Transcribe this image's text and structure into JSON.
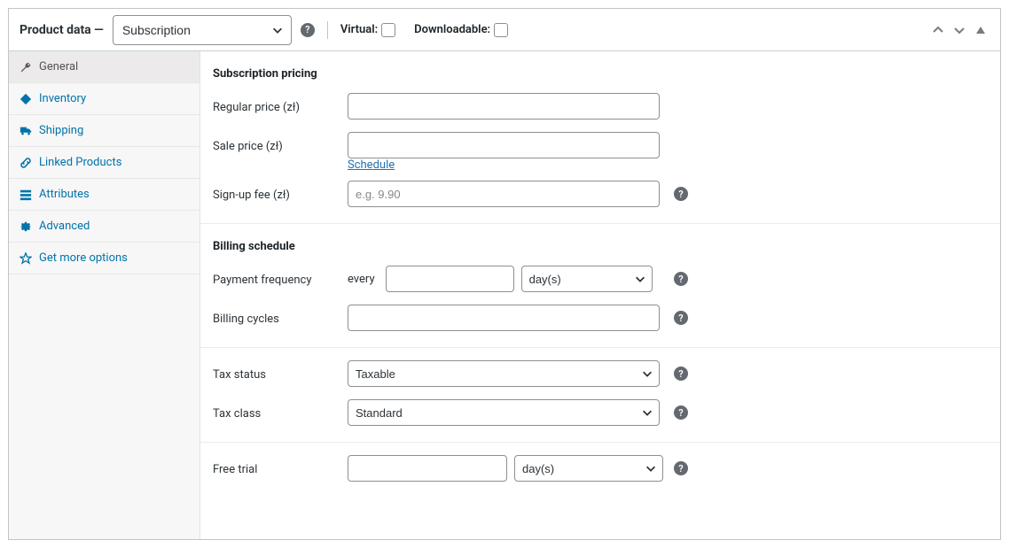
{
  "header": {
    "title": "Product data —",
    "product_type_selected": "Subscription",
    "virtual_label": "Virtual:",
    "downloadable_label": "Downloadable:"
  },
  "tabs": [
    {
      "key": "general",
      "label": "General",
      "icon": "wrench-icon",
      "active": true
    },
    {
      "key": "inventory",
      "label": "Inventory",
      "icon": "diamond-icon",
      "active": false
    },
    {
      "key": "shipping",
      "label": "Shipping",
      "icon": "truck-icon",
      "active": false
    },
    {
      "key": "linked",
      "label": "Linked Products",
      "icon": "link-icon",
      "active": false
    },
    {
      "key": "attrs",
      "label": "Attributes",
      "icon": "list-icon",
      "active": false
    },
    {
      "key": "advanced",
      "label": "Advanced",
      "icon": "gear-icon",
      "active": false
    },
    {
      "key": "more",
      "label": "Get more options",
      "icon": "star-icon",
      "active": false
    }
  ],
  "sections": {
    "pricing": {
      "title": "Subscription pricing",
      "regular_label": "Regular price (zł)",
      "regular_value": "",
      "sale_label": "Sale price (zł)",
      "sale_value": "",
      "schedule_link": "Schedule",
      "signup_label": "Sign-up fee (zł)",
      "signup_value": "",
      "signup_placeholder": "e.g. 9.90"
    },
    "billing": {
      "title": "Billing schedule",
      "freq_label": "Payment frequency",
      "every_text": "every",
      "freq_value": "",
      "freq_unit_selected": "day(s)",
      "cycles_label": "Billing cycles",
      "cycles_value": ""
    },
    "tax": {
      "status_label": "Tax status",
      "status_selected": "Taxable",
      "class_label": "Tax class",
      "class_selected": "Standard"
    },
    "trial": {
      "label": "Free trial",
      "value": "",
      "unit_selected": "day(s)"
    }
  }
}
